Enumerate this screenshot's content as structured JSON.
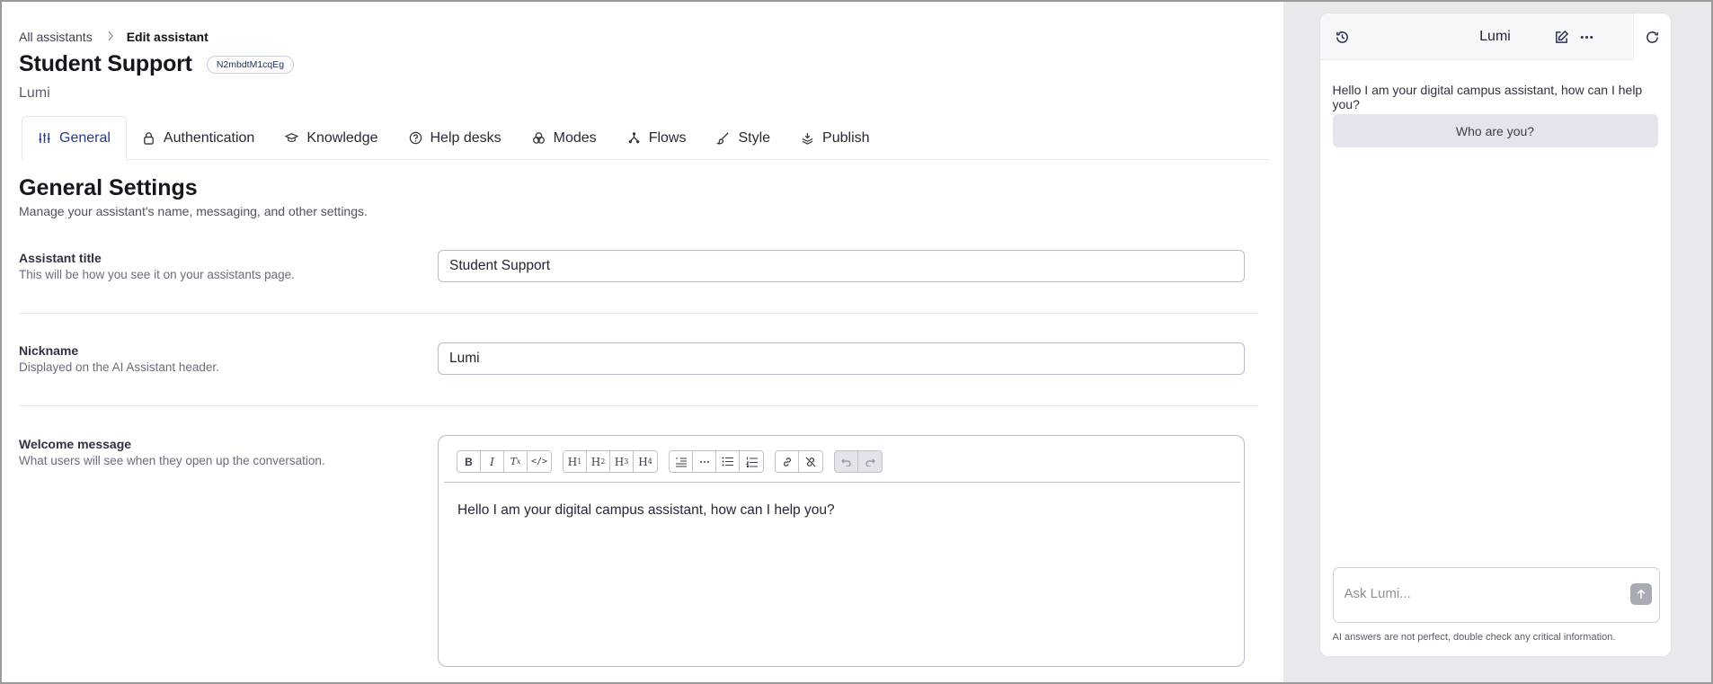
{
  "breadcrumb": {
    "parent": "All assistants",
    "separator": ">",
    "current": "Edit assistant"
  },
  "header": {
    "title": "Student Support",
    "id_badge": "N2mbdtM1cqEg",
    "subtitle": "Lumi"
  },
  "tabs": [
    {
      "label": "General",
      "icon": "sliders-icon",
      "active": true
    },
    {
      "label": "Authentication",
      "icon": "lock-icon"
    },
    {
      "label": "Knowledge",
      "icon": "graduation-cap-icon"
    },
    {
      "label": "Help desks",
      "icon": "help-circle-icon"
    },
    {
      "label": "Modes",
      "icon": "circles-icon"
    },
    {
      "label": "Flows",
      "icon": "flow-icon"
    },
    {
      "label": "Style",
      "icon": "brush-icon"
    },
    {
      "label": "Publish",
      "icon": "stack-icon"
    }
  ],
  "section": {
    "title": "General Settings",
    "description": "Manage your assistant's name, messaging, and other settings."
  },
  "fields": {
    "assistant_title": {
      "label": "Assistant title",
      "help": "This will be how you see it on your assistants page.",
      "value": "Student Support"
    },
    "nickname": {
      "label": "Nickname",
      "help": "Displayed on the AI Assistant header.",
      "value": "Lumi"
    },
    "welcome_message": {
      "label": "Welcome message",
      "help": "What users will see when they open up the conversation.",
      "value": "Hello I am your digital campus assistant, how can I help you?"
    }
  },
  "toolbar": {
    "format": [
      "B",
      "I",
      "Tx",
      "</>"
    ],
    "headings": [
      "H1",
      "H2",
      "H3",
      "H4"
    ],
    "lists": [
      "quote",
      "hr",
      "ul",
      "ol"
    ],
    "links": [
      "link",
      "unlink"
    ],
    "history": [
      "undo",
      "redo"
    ]
  },
  "chat": {
    "title": "Lumi",
    "welcome": "Hello I am your digital campus assistant, how can I help you?",
    "suggestion": "Who are you?",
    "input_placeholder": "Ask Lumi...",
    "disclaimer": "AI answers are not perfect, double check any critical information."
  },
  "colors": {
    "accent": "#243a8a",
    "panel_bg": "#e8e9ec",
    "chip_bg": "#e4e5ec"
  }
}
